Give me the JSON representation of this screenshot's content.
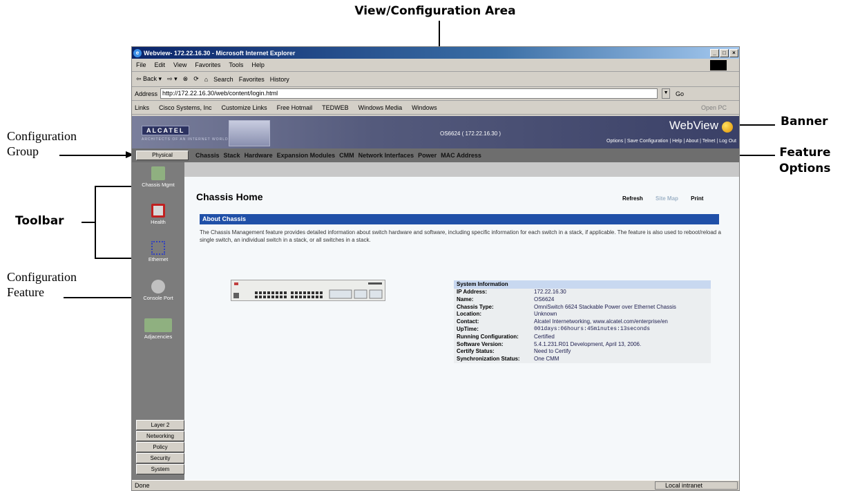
{
  "annotations": {
    "view_area": "View/Configuration Area",
    "configuration_group": "Configuration\nGroup",
    "toolbar": "Toolbar",
    "configuration_feature": "Configuration\nFeature",
    "banner": "Banner",
    "feature_options": "Feature\nOptions"
  },
  "browser": {
    "title": "Webview- 172.22.16.30 - Microsoft Internet Explorer",
    "menu": [
      "File",
      "Edit",
      "View",
      "Favorites",
      "Tools",
      "Help"
    ],
    "toolbar": [
      "⇦ Back ▾",
      "⇨ ▾",
      "⊗",
      "⟳",
      "⌂",
      "Search",
      "Favorites",
      "History"
    ],
    "address_label": "Address",
    "address": "http://172.22.16.30/web/content/login.html",
    "go": "Go",
    "links_label": "Links",
    "links": [
      "Cisco Systems, Inc",
      "Customize Links",
      "Free Hotmail",
      "TEDWEB",
      "Windows Media",
      "Windows"
    ],
    "open_pc": "Open PC",
    "status": "Done",
    "zone": "Local intranet"
  },
  "webview": {
    "alcatel": "ALCATEL",
    "alcatel_sub": "ARCHITECTS OF AN INTERNET WORLD",
    "device_id": "OS6624 ( 172.22.16.30 )",
    "title": "WebView",
    "banner_links": "Options | Save Configuration | Help | About | Telnet | Log Out",
    "active_group": "Physical",
    "feature_options": [
      "Chassis",
      "Stack",
      "Hardware",
      "Expansion Modules",
      "CMM",
      "Network Interfaces",
      "Power",
      "MAC Address"
    ],
    "tools": [
      "Chassis Mgmt",
      "Health",
      "Ethernet",
      "Console Port",
      "Adjacencies"
    ],
    "groups": [
      "Layer 2",
      "Networking",
      "Policy",
      "Security",
      "System"
    ],
    "page_title": "Chassis Home",
    "page_links": [
      "Refresh",
      "Site Map",
      "Print"
    ],
    "about_header": "About Chassis",
    "about_text": "The Chassis Management feature provides detailed information about switch hardware and software, including specific information for each switch in a stack, if applicable. The feature is also used to reboot/reload a single switch, an individual switch in a stack, or all switches in a stack.",
    "sysinfo_header": "System Information",
    "sysinfo": [
      {
        "k": "IP Address:",
        "v": "172.22.16.30"
      },
      {
        "k": "Name:",
        "v": "OS6624"
      },
      {
        "k": "Chassis Type:",
        "v": "OmniSwitch 6624 Stackable Power over Ethernet Chassis"
      },
      {
        "k": "Location:",
        "v": "Unknown"
      },
      {
        "k": "Contact:",
        "v": "Alcatel Internetworking, www.alcatel.com/enterprise/en"
      },
      {
        "k": "UpTime:",
        "v": "001days:06hours:45minutes:13seconds"
      },
      {
        "k": "Running Configuration:",
        "v": "Certified"
      },
      {
        "k": "Software Version:",
        "v": "5.4.1.231.R01 Development, April 13, 2006."
      },
      {
        "k": "Certify Status:",
        "v": "Need to Certify"
      },
      {
        "k": "Synchronization Status:",
        "v": "One CMM"
      }
    ]
  }
}
